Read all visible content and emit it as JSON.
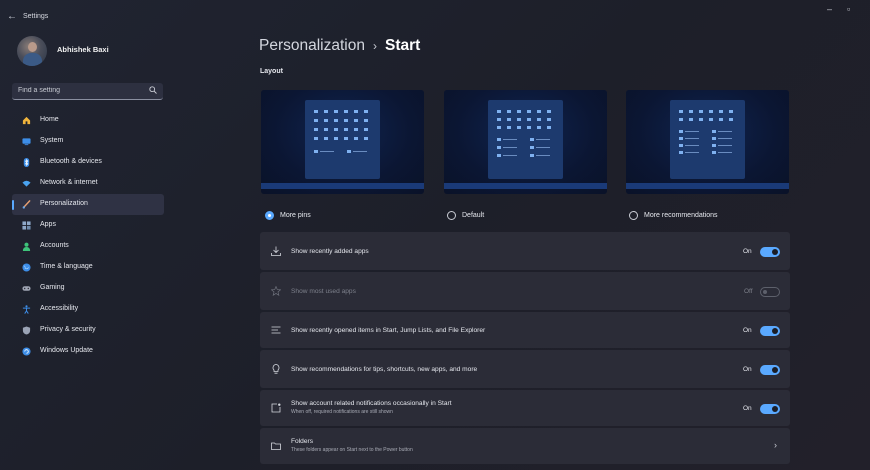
{
  "titlebar": {
    "back_glyph": "←",
    "title": "Settings",
    "minimize_glyph": "–",
    "maximize_glyph": "▫"
  },
  "profile": {
    "name": "Abhishek Baxi"
  },
  "search": {
    "placeholder": "Find a setting",
    "value": ""
  },
  "nav": [
    {
      "label": "Home",
      "icon": "home-icon",
      "color": "#f0b43c"
    },
    {
      "label": "System",
      "icon": "system-icon",
      "color": "#3d8ee8"
    },
    {
      "label": "Bluetooth & devices",
      "icon": "bluetooth-icon",
      "color": "#3d8ee8"
    },
    {
      "label": "Network & internet",
      "icon": "wifi-icon",
      "color": "#4aa3f0"
    },
    {
      "label": "Personalization",
      "icon": "brush-icon",
      "color": "#e8a070",
      "active": true
    },
    {
      "label": "Apps",
      "icon": "apps-icon",
      "color": "#8fa8c8"
    },
    {
      "label": "Accounts",
      "icon": "accounts-icon",
      "color": "#3ec47a"
    },
    {
      "label": "Time & language",
      "icon": "globe-icon",
      "color": "#3d8ee8"
    },
    {
      "label": "Gaming",
      "icon": "gaming-icon",
      "color": "#a0a6b4"
    },
    {
      "label": "Accessibility",
      "icon": "accessibility-icon",
      "color": "#3d8ee8"
    },
    {
      "label": "Privacy & security",
      "icon": "shield-icon",
      "color": "#9aa3b5"
    },
    {
      "label": "Windows Update",
      "icon": "update-icon",
      "color": "#3d8ee8"
    }
  ],
  "breadcrumb": {
    "parent": "Personalization",
    "separator": "›",
    "current": "Start"
  },
  "layout_section": {
    "title": "Layout"
  },
  "layout_options": [
    {
      "label": "More pins",
      "checked": true
    },
    {
      "label": "Default",
      "checked": false
    },
    {
      "label": "More recommendations",
      "checked": false
    }
  ],
  "settings": [
    {
      "label": "Show recently added apps",
      "icon": "download-icon",
      "state": "On",
      "on": true
    },
    {
      "label": "Show most used apps",
      "icon": "star-icon",
      "state": "Off",
      "on": false,
      "disabled": true
    },
    {
      "label": "Show recently opened items in Start, Jump Lists, and File Explorer",
      "icon": "list-icon",
      "state": "On",
      "on": true
    },
    {
      "label": "Show recommendations for tips, shortcuts, new apps, and more",
      "icon": "lightbulb-icon",
      "state": "On",
      "on": true
    },
    {
      "label": "Show account related notifications occasionally in Start",
      "sublabel": "When off, required notifications are still shown",
      "icon": "notification-icon",
      "state": "On",
      "on": true
    },
    {
      "label": "Folders",
      "sublabel": "These folders appear on Start next to the Power button",
      "icon": "folder-icon",
      "chevron": "›"
    }
  ],
  "colors": {
    "accent": "#5aa9ff",
    "row_bg": "#2b2c37",
    "sidebar_active": "#2f3244"
  }
}
